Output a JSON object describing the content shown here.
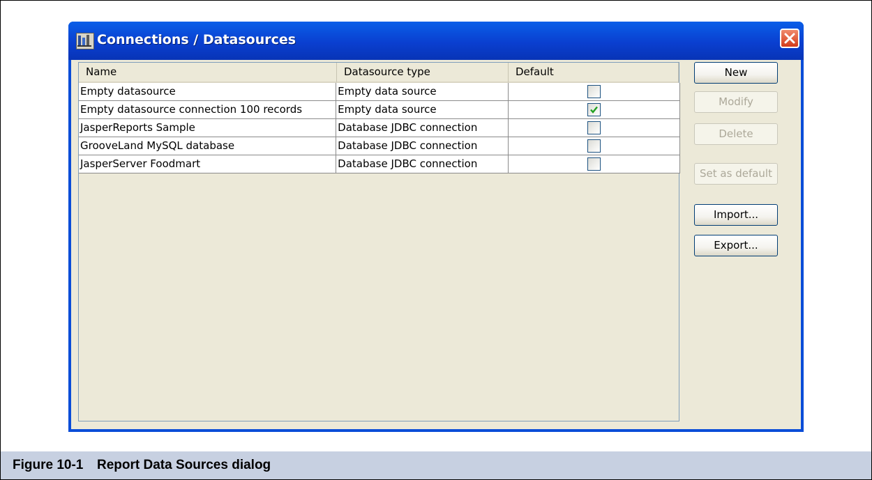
{
  "dialog": {
    "title": "Connections / Datasources",
    "icon": "jasperreports-app-icon",
    "close_icon": "close-icon"
  },
  "table": {
    "columns": [
      "Name",
      "Datasource type",
      "Default"
    ],
    "rows": [
      {
        "name": "Empty datasource",
        "type": "Empty data source",
        "default": false
      },
      {
        "name": "Empty datasource connection 100 records",
        "type": "Empty data source",
        "default": true
      },
      {
        "name": "JasperReports Sample",
        "type": "Database JDBC connection",
        "default": false
      },
      {
        "name": "GrooveLand MySQL database",
        "type": "Database JDBC connection",
        "default": false
      },
      {
        "name": "JasperServer Foodmart",
        "type": "Database JDBC connection",
        "default": false
      }
    ]
  },
  "buttons": {
    "new": "New",
    "modify": "Modify",
    "delete": "Delete",
    "set_default": "Set as default",
    "import": "Import...",
    "export": "Export..."
  },
  "button_states": {
    "modify_enabled": false,
    "delete_enabled": false,
    "set_default_enabled": false
  },
  "caption": {
    "figure_number": "Figure 10-1",
    "figure_title": "Report Data Sources dialog"
  },
  "colors": {
    "titlebar": "#0a4dd8",
    "dialog_bg": "#ece9d8",
    "caption_bg": "#c7d0e1",
    "check_green": "#21a121"
  }
}
